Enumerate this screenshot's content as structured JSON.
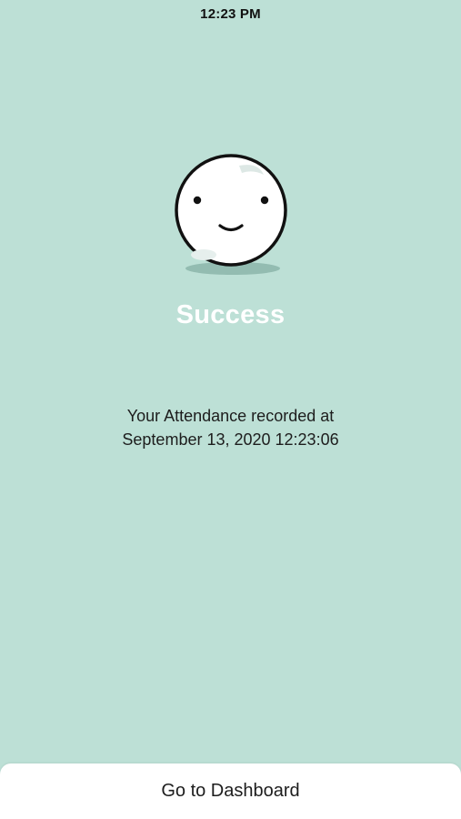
{
  "status_bar": {
    "time": "12:23 PM"
  },
  "mascot": {
    "icon": "smiley-ball-icon"
  },
  "success": {
    "title": "Success",
    "message_line1": "Your Attendance recorded at",
    "message_line2": "September 13, 2020 12:23:06"
  },
  "bottom": {
    "button_label": "Go to Dashboard"
  },
  "colors": {
    "background": "#bde0d6",
    "title": "#ffffff",
    "button_bar": "#ffffff"
  }
}
